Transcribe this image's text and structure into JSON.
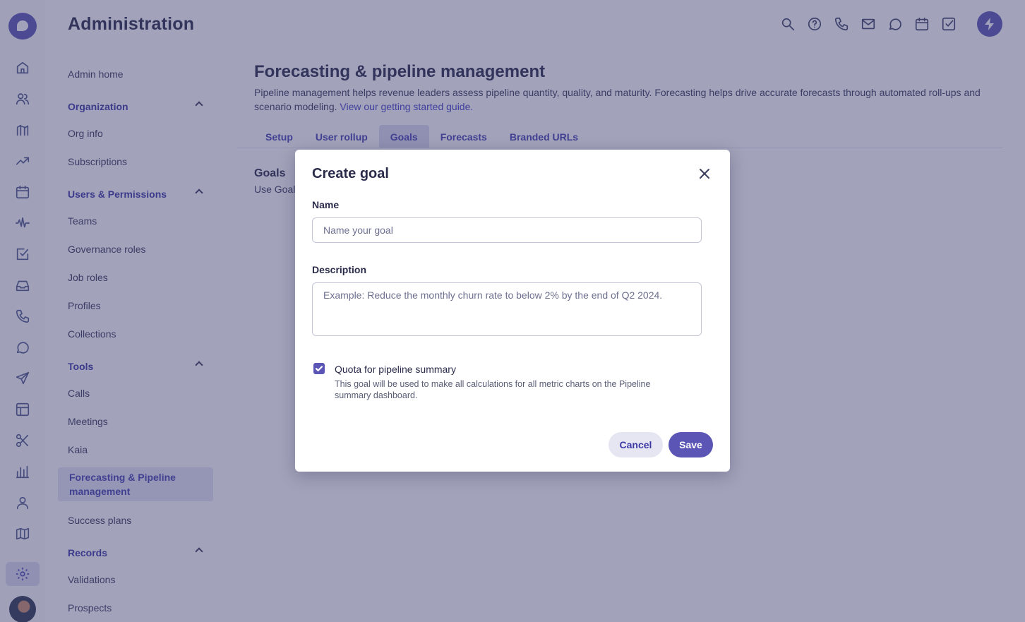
{
  "app": {
    "title": "Administration"
  },
  "rail": {
    "icons": [
      "logo-icon",
      "home-icon",
      "people-icon",
      "deals-icon",
      "trend-icon",
      "calendar-icon",
      "activity-icon",
      "tasks-icon",
      "inbox-icon",
      "phone-icon",
      "chat-icon",
      "send-icon",
      "layout-icon",
      "scissors-icon",
      "bar-chart-icon",
      "person-icon",
      "map-icon",
      "gear-icon",
      "avatar"
    ]
  },
  "topbar": {
    "icons": [
      "search-icon",
      "help-icon",
      "phone-icon",
      "mail-icon",
      "chat-icon",
      "calendar-icon",
      "task-icon",
      "bolt-icon"
    ]
  },
  "sidenav": {
    "admin_home": "Admin home",
    "organization": "Organization",
    "org_info": "Org info",
    "subscriptions": "Subscriptions",
    "users_permissions": "Users & Permissions",
    "teams": "Teams",
    "governance_roles": "Governance roles",
    "job_roles": "Job roles",
    "profiles": "Profiles",
    "collections": "Collections",
    "tools": "Tools",
    "calls": "Calls",
    "meetings": "Meetings",
    "kaia": "Kaia",
    "forecasting": "Forecasting & Pipeline management",
    "success_plans": "Success plans",
    "records": "Records",
    "validations": "Validations",
    "prospects": "Prospects"
  },
  "page": {
    "title": "Forecasting & pipeline management",
    "description": "Pipeline management helps revenue leaders assess pipeline quantity, quality, and maturity. Forecasting helps drive accurate forecasts through automated roll-ups and scenario modeling.",
    "guide_link": "View our getting started guide.",
    "tabs": [
      "Setup",
      "User rollup",
      "Goals",
      "Forecasts",
      "Branded URLs"
    ],
    "active_tab": "Goals",
    "section_title": "Goals",
    "section_desc": "Use Goals"
  },
  "modal": {
    "title": "Create goal",
    "name_label": "Name",
    "name_value": "",
    "name_placeholder": "Name your goal",
    "description_label": "Description",
    "description_value": "",
    "description_placeholder": "Example: Reduce the monthly churn rate to below 2% by the end of Q2 2024.",
    "checkbox_checked": true,
    "checkbox_label": "Quota for pipeline summary",
    "checkbox_help": "This goal will be used to make all calculations for all metric charts on the Pipeline summary dashboard.",
    "cancel_label": "Cancel",
    "save_label": "Save"
  },
  "colors": {
    "accent": "#5b56b5",
    "link": "#4643c7",
    "overlay": "rgba(60,60,110,0.48)"
  }
}
